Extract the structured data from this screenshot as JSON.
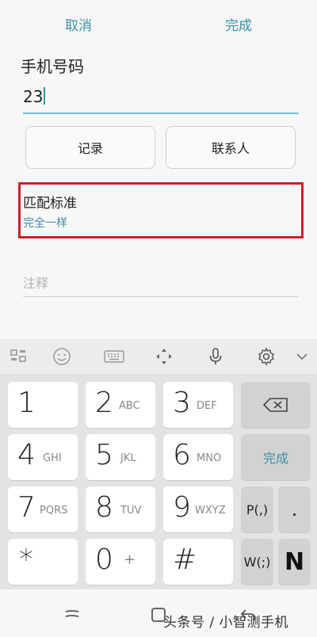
{
  "header": {
    "cancel_label": "取消",
    "done_label": "完成"
  },
  "form": {
    "title": "手机号码",
    "phone_value": "23",
    "record_button": "记录",
    "contacts_button": "联系人",
    "match_title": "匹配标准",
    "match_value": "完全一样",
    "note_placeholder": "注释"
  },
  "keyboard": {
    "keys": [
      {
        "num": "1",
        "letters": ""
      },
      {
        "num": "2",
        "letters": "ABC"
      },
      {
        "num": "3",
        "letters": "DEF"
      },
      {
        "num": "4",
        "letters": "GHI"
      },
      {
        "num": "5",
        "letters": "JKL"
      },
      {
        "num": "6",
        "letters": "MNO"
      },
      {
        "num": "7",
        "letters": "PQRS"
      },
      {
        "num": "8",
        "letters": "TUV"
      },
      {
        "num": "9",
        "letters": "WXYZ"
      },
      {
        "num": "*",
        "letters": ""
      },
      {
        "num": "0",
        "letters": "+"
      },
      {
        "num": "#",
        "letters": ""
      }
    ],
    "done_key": "完成",
    "pause_key": "P(,)",
    "period_key": ".",
    "wait_key": "W(;)",
    "n_key": "N"
  },
  "watermark": "头条号 / 小智测手机",
  "accent_color": "#3a8fa8",
  "highlight_color": "#cc1f2a"
}
